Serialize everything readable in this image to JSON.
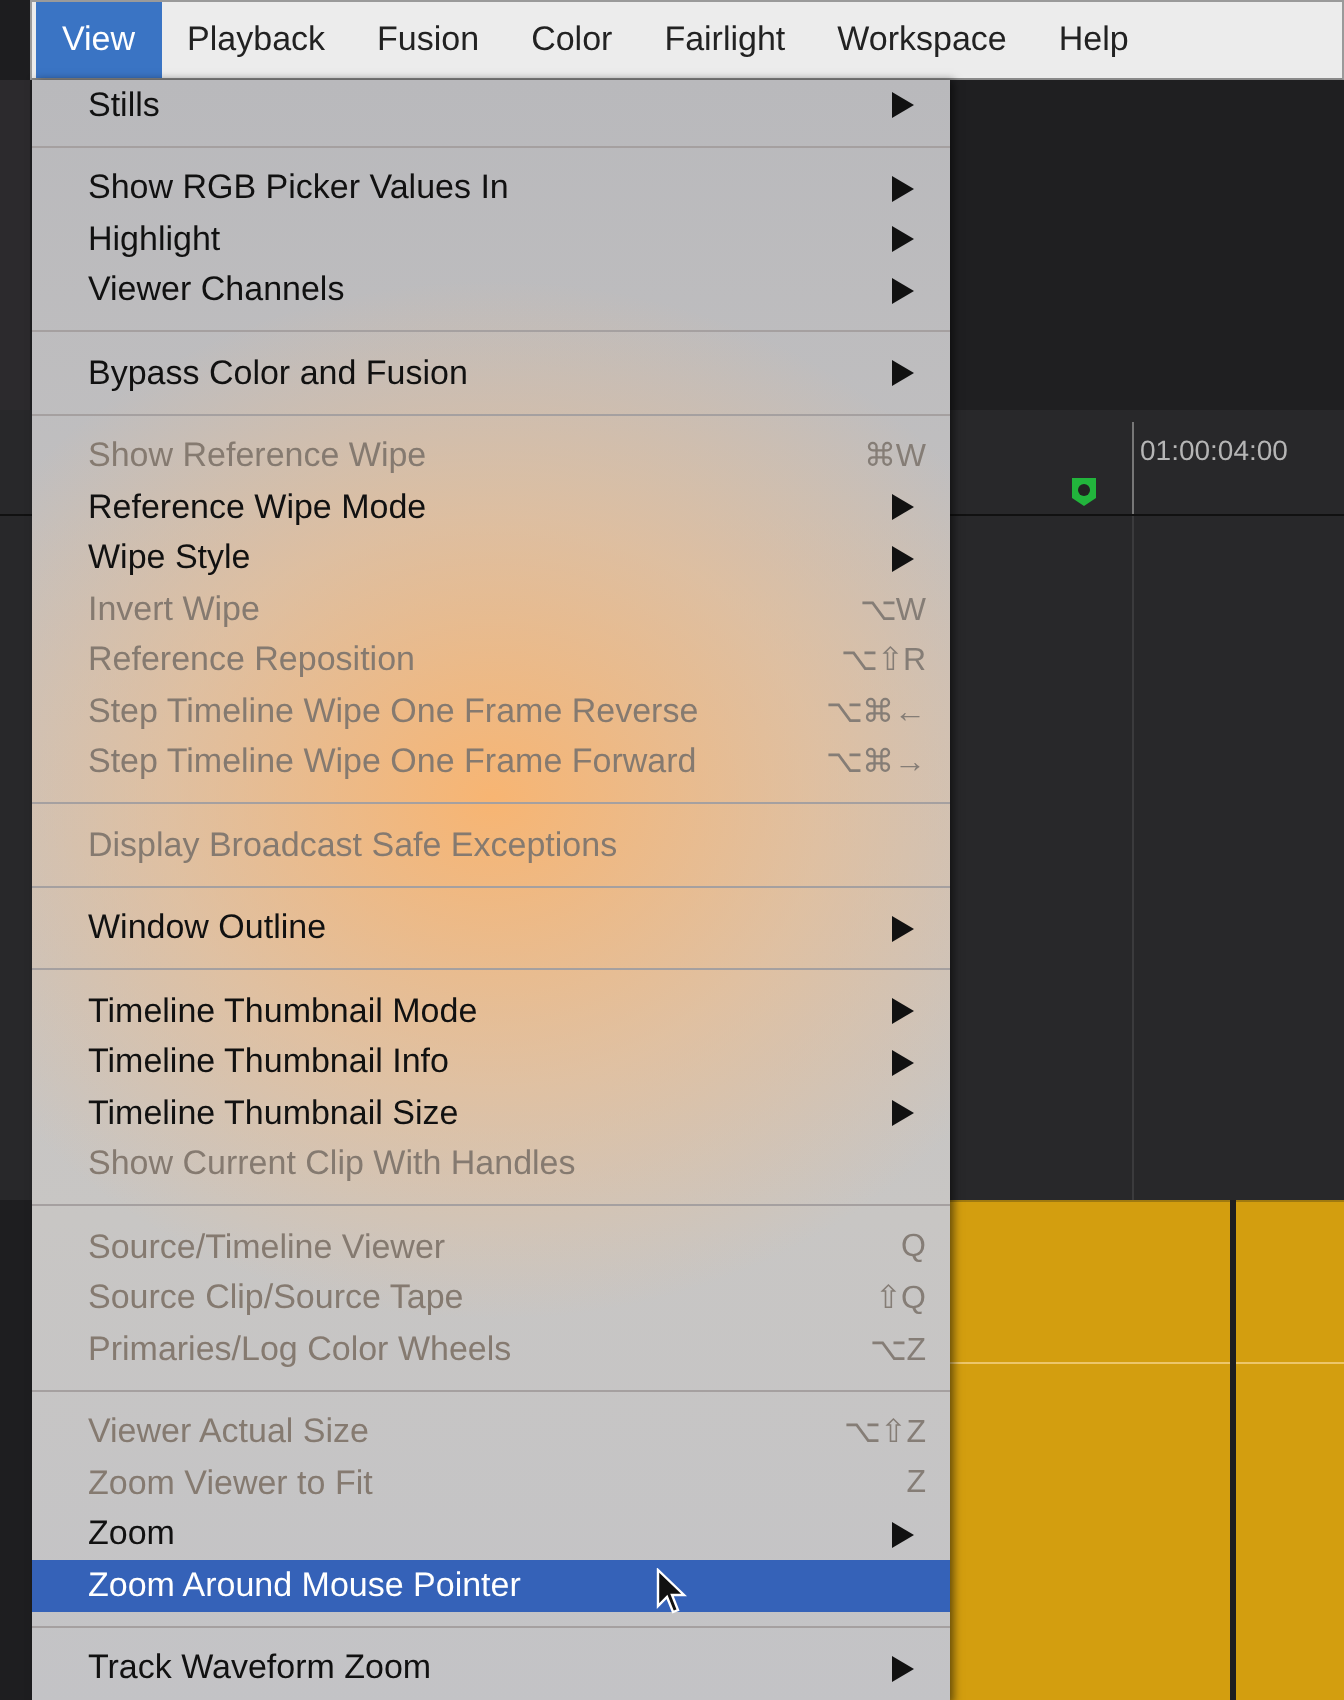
{
  "menu_bar": [
    {
      "label": "View",
      "selected": true
    },
    {
      "label": "Playback",
      "selected": false
    },
    {
      "label": "Fusion",
      "selected": false
    },
    {
      "label": "Color",
      "selected": false
    },
    {
      "label": "Fairlight",
      "selected": false
    },
    {
      "label": "Workspace",
      "selected": false
    },
    {
      "label": "Help",
      "selected": false
    }
  ],
  "menu": {
    "sections": [
      [
        {
          "label": "Stills",
          "kind": "submenu",
          "disabled": false,
          "selected": false
        }
      ],
      [
        {
          "label": "Show RGB Picker Values In",
          "kind": "submenu",
          "disabled": false,
          "selected": false
        },
        {
          "label": "Highlight",
          "kind": "submenu",
          "disabled": false,
          "selected": false
        },
        {
          "label": "Viewer Channels",
          "kind": "submenu",
          "disabled": false,
          "selected": false
        }
      ],
      [
        {
          "label": "Bypass Color and Fusion",
          "kind": "submenu",
          "disabled": false,
          "selected": false
        }
      ],
      [
        {
          "label": "Show Reference Wipe",
          "kind": "shortcut",
          "shortcut": "⌘W",
          "disabled": true,
          "selected": false
        },
        {
          "label": "Reference Wipe Mode",
          "kind": "submenu",
          "disabled": false,
          "selected": false
        },
        {
          "label": "Wipe Style",
          "kind": "submenu",
          "disabled": false,
          "selected": false
        },
        {
          "label": "Invert Wipe",
          "kind": "shortcut",
          "shortcut": "⌥W",
          "disabled": true,
          "selected": false
        },
        {
          "label": "Reference Reposition",
          "kind": "shortcut",
          "shortcut": "⌥⇧R",
          "disabled": true,
          "selected": false
        },
        {
          "label": "Step Timeline Wipe One Frame Reverse",
          "kind": "shortcut",
          "shortcut": "⌥⌘←",
          "disabled": true,
          "selected": false
        },
        {
          "label": "Step Timeline Wipe One Frame Forward",
          "kind": "shortcut",
          "shortcut": "⌥⌘→",
          "disabled": true,
          "selected": false
        }
      ],
      [
        {
          "label": "Display Broadcast Safe Exceptions",
          "kind": "plain",
          "disabled": true,
          "selected": false
        }
      ],
      [
        {
          "label": "Window Outline",
          "kind": "submenu",
          "disabled": false,
          "selected": false
        }
      ],
      [
        {
          "label": "Timeline Thumbnail Mode",
          "kind": "submenu",
          "disabled": false,
          "selected": false
        },
        {
          "label": "Timeline Thumbnail Info",
          "kind": "submenu",
          "disabled": false,
          "selected": false
        },
        {
          "label": "Timeline Thumbnail Size",
          "kind": "submenu",
          "disabled": false,
          "selected": false
        },
        {
          "label": "Show Current Clip With Handles",
          "kind": "plain",
          "disabled": true,
          "selected": false
        }
      ],
      [
        {
          "label": "Source/Timeline Viewer",
          "kind": "shortcut",
          "shortcut": "Q",
          "disabled": true,
          "selected": false
        },
        {
          "label": "Source Clip/Source Tape",
          "kind": "shortcut",
          "shortcut": "⇧Q",
          "disabled": true,
          "selected": false
        },
        {
          "label": "Primaries/Log Color Wheels",
          "kind": "shortcut",
          "shortcut": "⌥Z",
          "disabled": true,
          "selected": false
        }
      ],
      [
        {
          "label": "Viewer Actual Size",
          "kind": "shortcut",
          "shortcut": "⌥⇧Z",
          "disabled": true,
          "selected": false
        },
        {
          "label": "Zoom Viewer to Fit",
          "kind": "shortcut",
          "shortcut": "Z",
          "disabled": true,
          "selected": false
        },
        {
          "label": "Zoom",
          "kind": "submenu",
          "disabled": false,
          "selected": false
        },
        {
          "label": "Zoom Around Mouse Pointer",
          "kind": "plain",
          "disabled": false,
          "selected": true
        }
      ],
      [
        {
          "label": "Track Waveform Zoom",
          "kind": "submenu",
          "disabled": false,
          "selected": false
        }
      ]
    ]
  },
  "timeline": {
    "timecode": "01:00:04:00"
  }
}
